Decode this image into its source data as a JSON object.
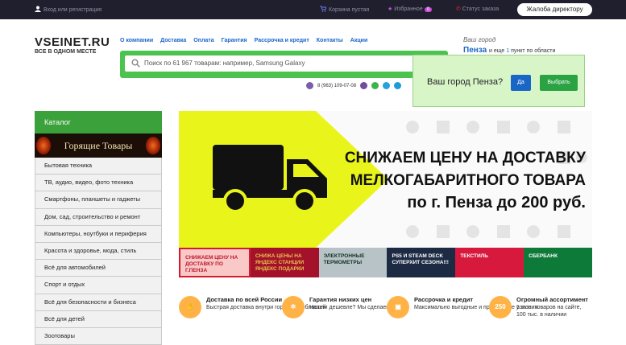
{
  "topbar": {
    "login": "Вход или регистрация",
    "cart": "Корзина пустая",
    "favorites": "Избранное",
    "favorites_count": "0",
    "order_status": "Статус заказа",
    "complain": "Жалоба директору"
  },
  "logo": {
    "name": "VSEINET.RU",
    "slogan": "ВСЕ В ОДНОМ МЕСТЕ"
  },
  "nav": [
    "О компании",
    "Доставка",
    "Оплата",
    "Гарантия",
    "Рассрочка и кредит",
    "Контакты",
    "Акции"
  ],
  "city": {
    "label": "Ваш город",
    "name": "Пенза",
    "extra_pre": "и еще",
    "extra_count": "1",
    "extra_post": "пункт по области"
  },
  "search": {
    "placeholder": "Поиск по 61 967 товарам: например, Samsung Galaxy"
  },
  "phone": "8 (963) 109-07-08",
  "popup": {
    "question": "Ваш город Пенза?",
    "yes": "Да",
    "choose": "Выбрать"
  },
  "catalog": {
    "title": "Каталог",
    "hot": "Горящие Товары",
    "items": [
      "Бытовая техника",
      "ТВ, аудио, видео, фото техника",
      "Смартфоны, планшеты и гаджеты",
      "Дом, сад, строительство и ремонт",
      "Компьютеры, ноутбуки и периферия",
      "Красота и здоровье, мода, стиль",
      "Всё для автомобилей",
      "Спорт и отдых",
      "Всё для безопасности и бизнеса",
      "Всё для детей",
      "Зоотовары"
    ]
  },
  "banner": {
    "line1": "СНИЖАЕМ ЦЕНУ НА ДОСТАВКУ",
    "line2": "МЕЛКОГАБАРИТНОГО ТОВАРА",
    "line3": "по г. Пенза до 200 руб."
  },
  "tiles": [
    "СНИЖАЕМ ЦЕНУ НА ДОСТАВКУ ПО Г.ПЕНЗА",
    "СНИЖА ЦЕНЫ НА ЯНДЕКС СТАНЦИИ ЯНДЕКС ПОДАРКИ",
    "ЭЛЕКТРОННЫЕ ТЕРМОМЕТРЫ",
    "PS5 И STEAM DECK СУПЕРХИТ СЕЗОНА!!!",
    "ТЕКСТИЛЬ",
    "СБЕРБАНК"
  ],
  "features": [
    {
      "icon": "",
      "title": "Доставка по всей России",
      "desc": "Быстрая доставка внутри городов и областей"
    },
    {
      "icon": "",
      "title": "Гарантия низких цен",
      "desc": "Нашли дешевле? Мы сделаем ниже!"
    },
    {
      "icon": "",
      "title": "Рассрочка и кредит",
      "desc": "Максимально выгодные и прозрачные условия."
    },
    {
      "icon": "250",
      "title": "Огромный ассортимент",
      "desc": "1 млн. товаров на сайте, 100 тыс. в наличии"
    }
  ]
}
